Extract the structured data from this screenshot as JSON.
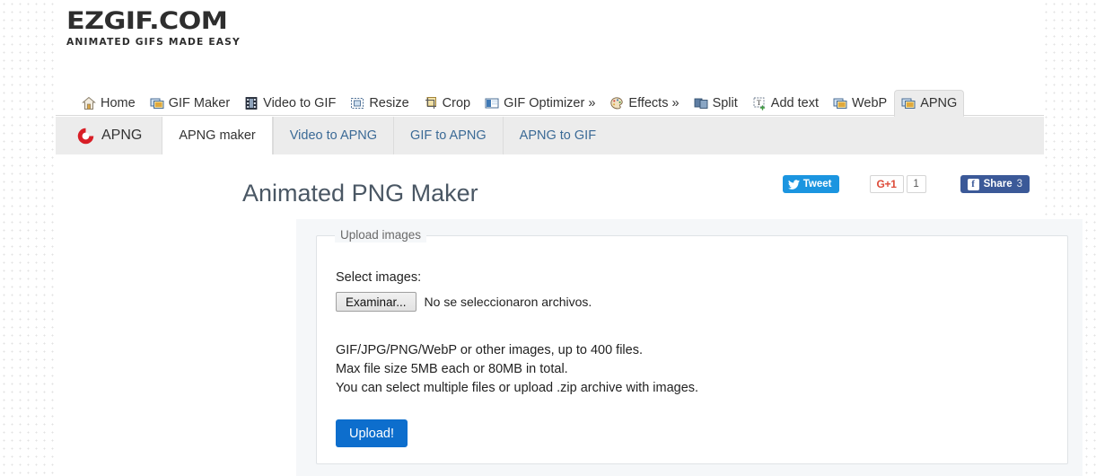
{
  "brand": {
    "name": "EZGIF.COM",
    "tagline": "ANIMATED GIFS MADE EASY"
  },
  "topnav": {
    "items": [
      {
        "label": "Home",
        "icon": "home-icon",
        "active": false
      },
      {
        "label": "GIF Maker",
        "icon": "gif-maker-icon",
        "active": false
      },
      {
        "label": "Video to GIF",
        "icon": "video-icon",
        "active": false
      },
      {
        "label": "Resize",
        "icon": "resize-icon",
        "active": false
      },
      {
        "label": "Crop",
        "icon": "crop-icon",
        "active": false
      },
      {
        "label": "GIF Optimizer »",
        "icon": "optimizer-icon",
        "active": false
      },
      {
        "label": "Effects »",
        "icon": "effects-icon",
        "active": false
      },
      {
        "label": "Split",
        "icon": "split-icon",
        "active": false
      },
      {
        "label": "Add text",
        "icon": "add-text-icon",
        "active": false
      },
      {
        "label": "WebP",
        "icon": "webp-icon",
        "active": false
      },
      {
        "label": "APNG",
        "icon": "apng-icon",
        "active": true
      }
    ]
  },
  "subnav": {
    "brand_label": "APNG",
    "brand_icon": "apng-logo-icon",
    "tabs": [
      {
        "label": "APNG maker",
        "active": true
      },
      {
        "label": "Video to APNG",
        "active": false
      },
      {
        "label": "GIF to APNG",
        "active": false
      },
      {
        "label": "APNG to GIF",
        "active": false
      }
    ]
  },
  "page": {
    "title": "Animated PNG Maker"
  },
  "social": {
    "tweet_label": "Tweet",
    "tweet_icon": "twitter-bird-icon",
    "gplus_label": "G+1",
    "gplus_count": "1",
    "share_label": "Share",
    "share_count": "3",
    "share_icon": "facebook-icon"
  },
  "upload": {
    "legend": "Upload images",
    "select_label": "Select images:",
    "browse_button": "Examinar...",
    "file_status": "No se seleccionaron archivos.",
    "help_line_1": "GIF/JPG/PNG/WebP or other images, up to 400 files.",
    "help_line_2": "Max file size 5MB each or 80MB in total.",
    "help_line_3": "You can select multiple files or upload .zip archive with images.",
    "submit_label": "Upload!"
  },
  "colors": {
    "accent_blue": "#0d6ecd",
    "twitter_blue": "#1b95e0",
    "facebook_blue": "#3b5998",
    "gplus_red": "#dd4b39",
    "apng_red": "#d81e26",
    "title_slate": "#4a5764",
    "link_blue": "#3b6a96",
    "panel_bg": "#f5f7f9",
    "subnav_bg": "#ececec"
  }
}
